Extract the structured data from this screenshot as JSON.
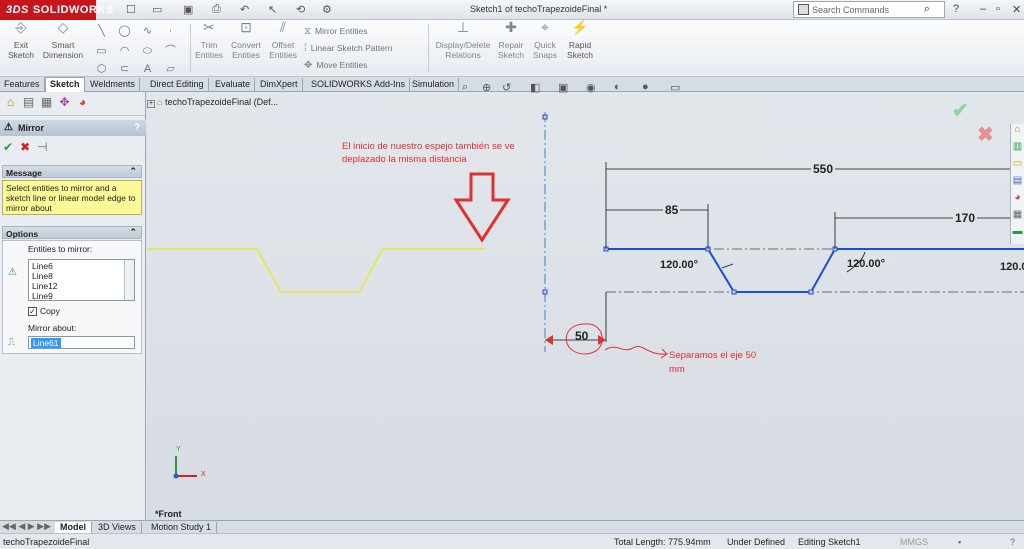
{
  "app": {
    "brand_prefix": "3DS",
    "brand": "SOLIDWORKS",
    "doc_title": "Sketch1 of techoTrapezoideFinal *"
  },
  "search": {
    "placeholder": "Search Commands"
  },
  "ribbon": {
    "exit_sketch": "Exit Sketch",
    "smart_dimension": "Smart Dimension",
    "trim_entities": "Trim Entities",
    "convert_entities": "Convert Entities",
    "offset_entities": "Offset Entities",
    "mirror_entities": "Mirror Entities",
    "linear_sketch_pattern": "Linear Sketch Pattern",
    "move_entities": "Move Entities",
    "display_delete_relations": "Display/Delete Relations",
    "repair_sketch": "Repair Sketch",
    "quick_snaps": "Quick Snaps",
    "rapid_sketch": "Rapid Sketch"
  },
  "tabs": [
    "Features",
    "Sketch",
    "Weldments",
    "Direct Editing",
    "Evaluate",
    "DimXpert",
    "SOLIDWORKS Add-Ins",
    "Simulation"
  ],
  "active_tab": "Sketch",
  "property_manager": {
    "title": "Mirror",
    "help": "?",
    "message_header": "Message",
    "message_text": "Select entities to mirror and a sketch line or linear model edge to mirror about",
    "options_header": "Options",
    "entities_label": "Entities to mirror:",
    "entities": [
      "Line6",
      "Line8",
      "Line12",
      "Line9"
    ],
    "copy_label": "Copy",
    "copy_checked": "✓",
    "mirror_about_label": "Mirror about:",
    "mirror_about_value": "Line61"
  },
  "tree": {
    "label": "techoTrapezoideFinal  (Def..."
  },
  "annotations": {
    "top_note_line1": "El inicio de nuestro espejo también se ve",
    "top_note_line2": "deplazado la misma distancia",
    "bottom_note_line1": "Separamos el eje 50",
    "bottom_note_line2": "mm"
  },
  "dimensions": {
    "d550": "550",
    "d85": "85",
    "d170": "170",
    "d50": "50",
    "a1": "120.00°",
    "a2": "120.00°",
    "a3": "120.0"
  },
  "view_label": "*Front",
  "triad": {
    "x": "X",
    "y": "Y"
  },
  "bottom_tabs": [
    "Model",
    "3D Views",
    "Motion Study 1"
  ],
  "status": {
    "file": "techoTrapezoideFinal",
    "total_length": "Total Length: 775.94mm",
    "defined": "Under Defined",
    "editing": "Editing Sketch1",
    "units": "MMGS"
  },
  "colors": {
    "sketch_blue": "#1a4fd6",
    "yellow": "#e8e830",
    "annotation_red": "#e03030",
    "brand_red": "#c8141c"
  }
}
